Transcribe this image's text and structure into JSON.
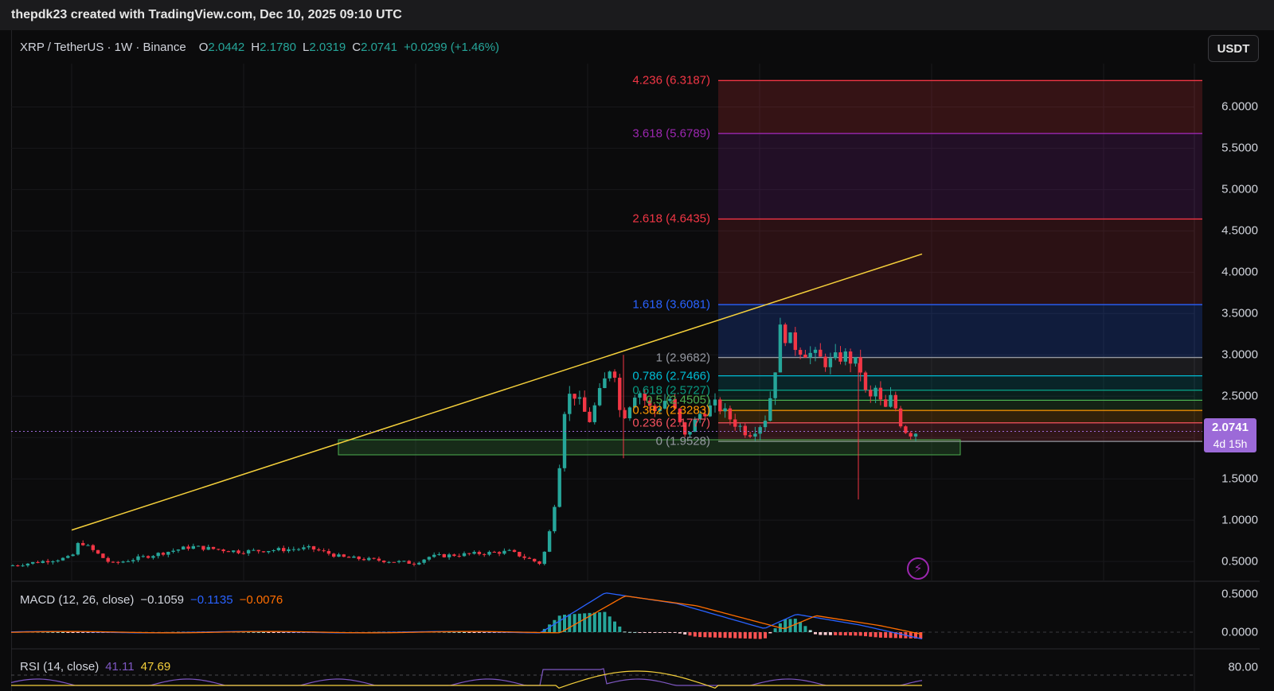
{
  "header": {
    "attribution": "thepdk23 created with TradingView.com, Dec 10, 2025 09:10 UTC"
  },
  "legend": {
    "symbol": "XRP / TetherUS · 1W · Binance",
    "open_key": "O",
    "open": "2.0442",
    "high_key": "H",
    "high": "2.1780",
    "low_key": "L",
    "low": "2.0319",
    "close_key": "C",
    "close": "2.0741",
    "change": "+0.0299 (+1.46%)"
  },
  "currency_button": "USDT",
  "price_axis": {
    "labels": [
      "6.0000",
      "5.5000",
      "5.0000",
      "4.5000",
      "4.0000",
      "3.5000",
      "3.0000",
      "2.5000",
      "1.5000",
      "1.0000",
      "0.5000"
    ],
    "values": [
      6.0,
      5.5,
      5.0,
      4.5,
      4.0,
      3.5,
      3.0,
      2.5,
      1.5,
      1.0,
      0.5
    ]
  },
  "last_price": {
    "value": "2.0741",
    "countdown": "4d 15h",
    "color": "#9c6ad8"
  },
  "fibonacci": [
    {
      "label": "4.236 (6.3187)",
      "price": 6.3187,
      "color": "#f23645"
    },
    {
      "label": "3.618 (5.6789)",
      "price": 5.6789,
      "color": "#9c27b0"
    },
    {
      "label": "2.618 (4.6435)",
      "price": 4.6435,
      "color": "#f23645"
    },
    {
      "label": "1.618 (3.6081)",
      "price": 3.6081,
      "color": "#2962ff"
    },
    {
      "label": "1 (2.9682)",
      "price": 2.9682,
      "color": "#9598a1"
    },
    {
      "label": "0.786 (2.7466)",
      "price": 2.7466,
      "color": "#00bcd4"
    },
    {
      "label": "0.618 (2.5727)",
      "price": 2.5727,
      "color": "#089981"
    },
    {
      "label": "0.5 (2.4505)",
      "price": 2.4505,
      "color": "#4caf50"
    },
    {
      "label": "0.382 (2.3283)",
      "price": 2.3283,
      "color": "#ff9800"
    },
    {
      "label": "0.236 (2.1777)",
      "price": 2.1777,
      "color": "#f7525f"
    },
    {
      "label": "0 (1.9528)",
      "price": 1.9528,
      "color": "#9598a1"
    }
  ],
  "macd": {
    "title": "MACD (12, 26, close)",
    "value1": "−0.1059",
    "value2": "−0.1135",
    "value3": "−0.0076",
    "axis_labels": [
      "0.5000",
      "0.0000"
    ]
  },
  "rsi": {
    "title": "RSI (14, close)",
    "value1": "41.11",
    "value2": "47.69",
    "axis_labels": [
      "80.00"
    ]
  },
  "colors": {
    "up": "#26a69a",
    "down": "#f23645",
    "trendline": "#f5d03b",
    "support_zone": "#4caf50",
    "macd_line": "#2962ff",
    "signal_line": "#ff6d00",
    "rsi_line": "#7e57c2",
    "rsi_ma": "#f5d03b"
  },
  "icons": {
    "lightning": "lightning-icon"
  }
}
